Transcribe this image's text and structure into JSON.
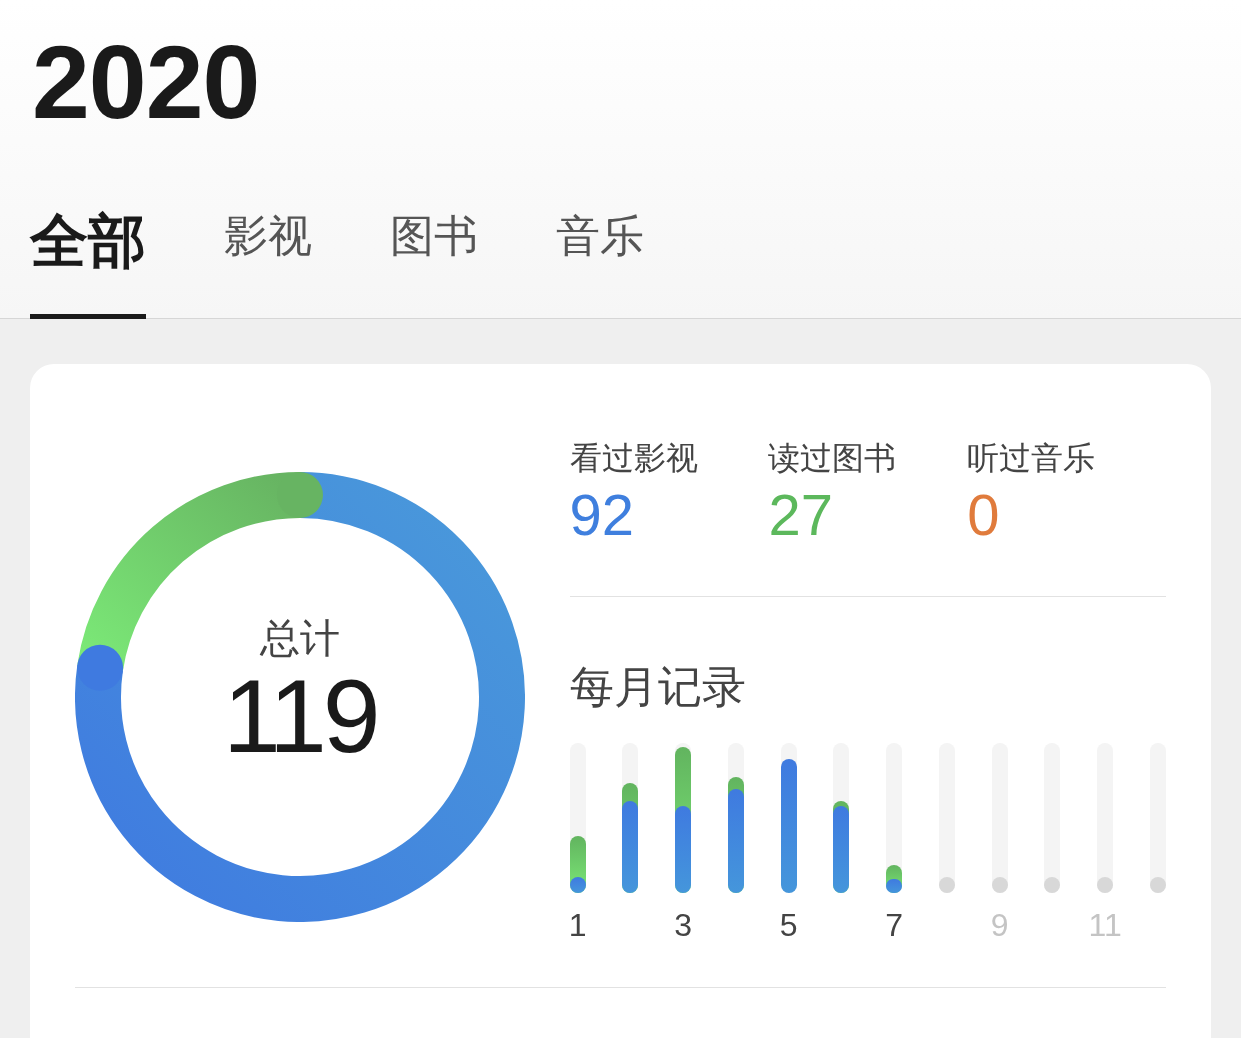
{
  "year": "2020",
  "tabs": [
    {
      "label": "全部",
      "selected": true
    },
    {
      "label": "影视",
      "selected": false
    },
    {
      "label": "图书",
      "selected": false
    },
    {
      "label": "音乐",
      "selected": false
    }
  ],
  "total": {
    "label": "总计",
    "value": "119"
  },
  "stats": [
    {
      "label": "看过影视",
      "value": "92",
      "color": "#3f7fde"
    },
    {
      "label": "读过图书",
      "value": "27",
      "color": "#5cb85c"
    },
    {
      "label": "听过音乐",
      "value": "0",
      "color": "#e07b3c"
    }
  ],
  "monthly": {
    "title": "每月记录",
    "labels": [
      {
        "text": "1",
        "dimmed": false
      },
      {
        "text": "3",
        "dimmed": false
      },
      {
        "text": "5",
        "dimmed": false
      },
      {
        "text": "7",
        "dimmed": false
      },
      {
        "text": "9",
        "dimmed": true
      },
      {
        "text": "11",
        "dimmed": true
      }
    ]
  }
}
